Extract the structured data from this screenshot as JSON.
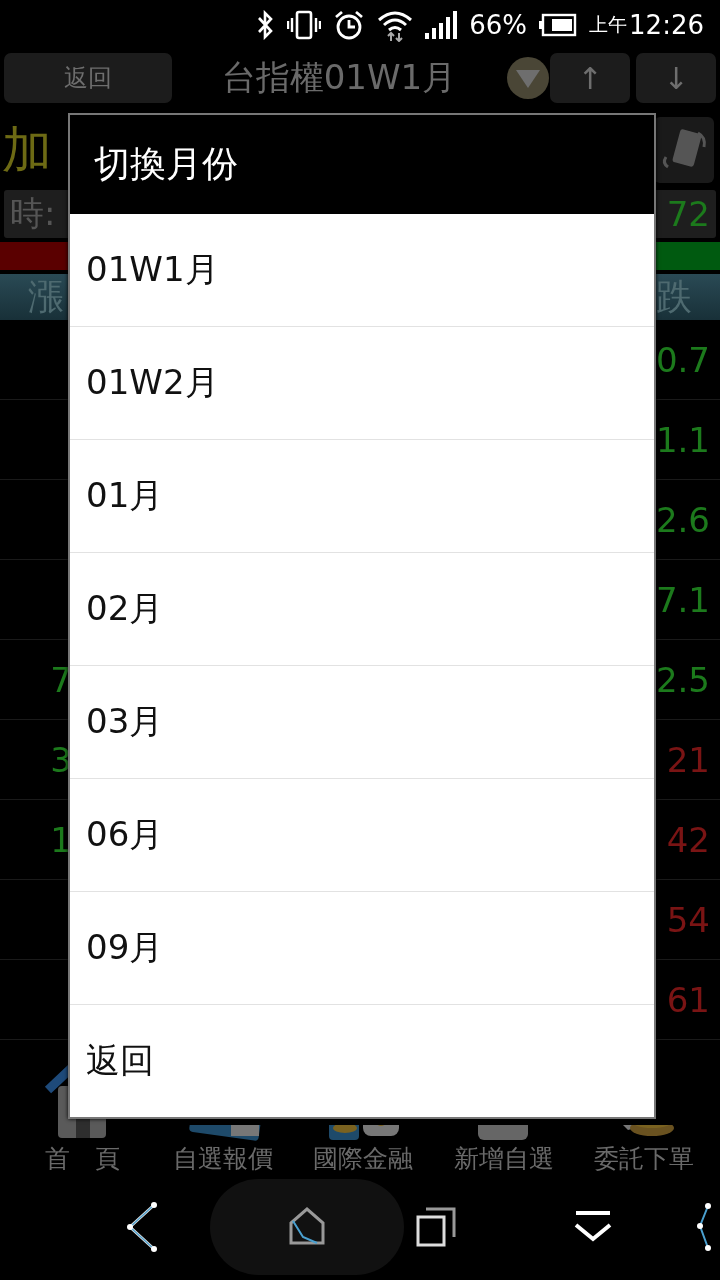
{
  "status_bar": {
    "battery": "66%",
    "ampm": "上午",
    "time": "12:26"
  },
  "toolbar": {
    "back": "返回",
    "title": "台指權01W1月",
    "up": "↑",
    "down": "↓"
  },
  "quote": {
    "name": "加",
    "time_label": "時:",
    "price": "72"
  },
  "table": {
    "header": [
      "漲",
      "跌"
    ],
    "rows": [
      {
        "right": {
          "text": "0.7",
          "color": "#1c7a1c"
        }
      },
      {
        "right": {
          "text": "1.1",
          "color": "#1c7a1c"
        }
      },
      {
        "right": {
          "text": "2.6",
          "color": "#1c7a1c"
        }
      },
      {
        "right": {
          "text": "7.1",
          "color": "#1c7a1c"
        }
      },
      {
        "left": {
          "text": "7",
          "color": "#1c7a1c"
        },
        "right": {
          "text": "2.5",
          "color": "#1c7a1c"
        }
      },
      {
        "left": {
          "text": "3",
          "color": "#1c7a1c"
        },
        "right": {
          "text": "21",
          "color": "#7a1414"
        }
      },
      {
        "left": {
          "text": "1",
          "color": "#1c7a1c"
        },
        "right": {
          "text": "42",
          "color": "#7a1414"
        }
      },
      {
        "right": {
          "text": "54",
          "color": "#7a1414"
        }
      },
      {
        "right": {
          "text": "61",
          "color": "#7a1414"
        }
      }
    ]
  },
  "tabs": [
    {
      "label": "首　頁"
    },
    {
      "label": "自選報價"
    },
    {
      "label": "國際金融"
    },
    {
      "label": "新增自選"
    },
    {
      "label": "委託下單"
    }
  ],
  "dialog": {
    "title": "切換月份",
    "items": [
      "01W1月",
      "01W2月",
      "01月",
      "02月",
      "03月",
      "06月",
      "09月",
      "返回"
    ]
  }
}
